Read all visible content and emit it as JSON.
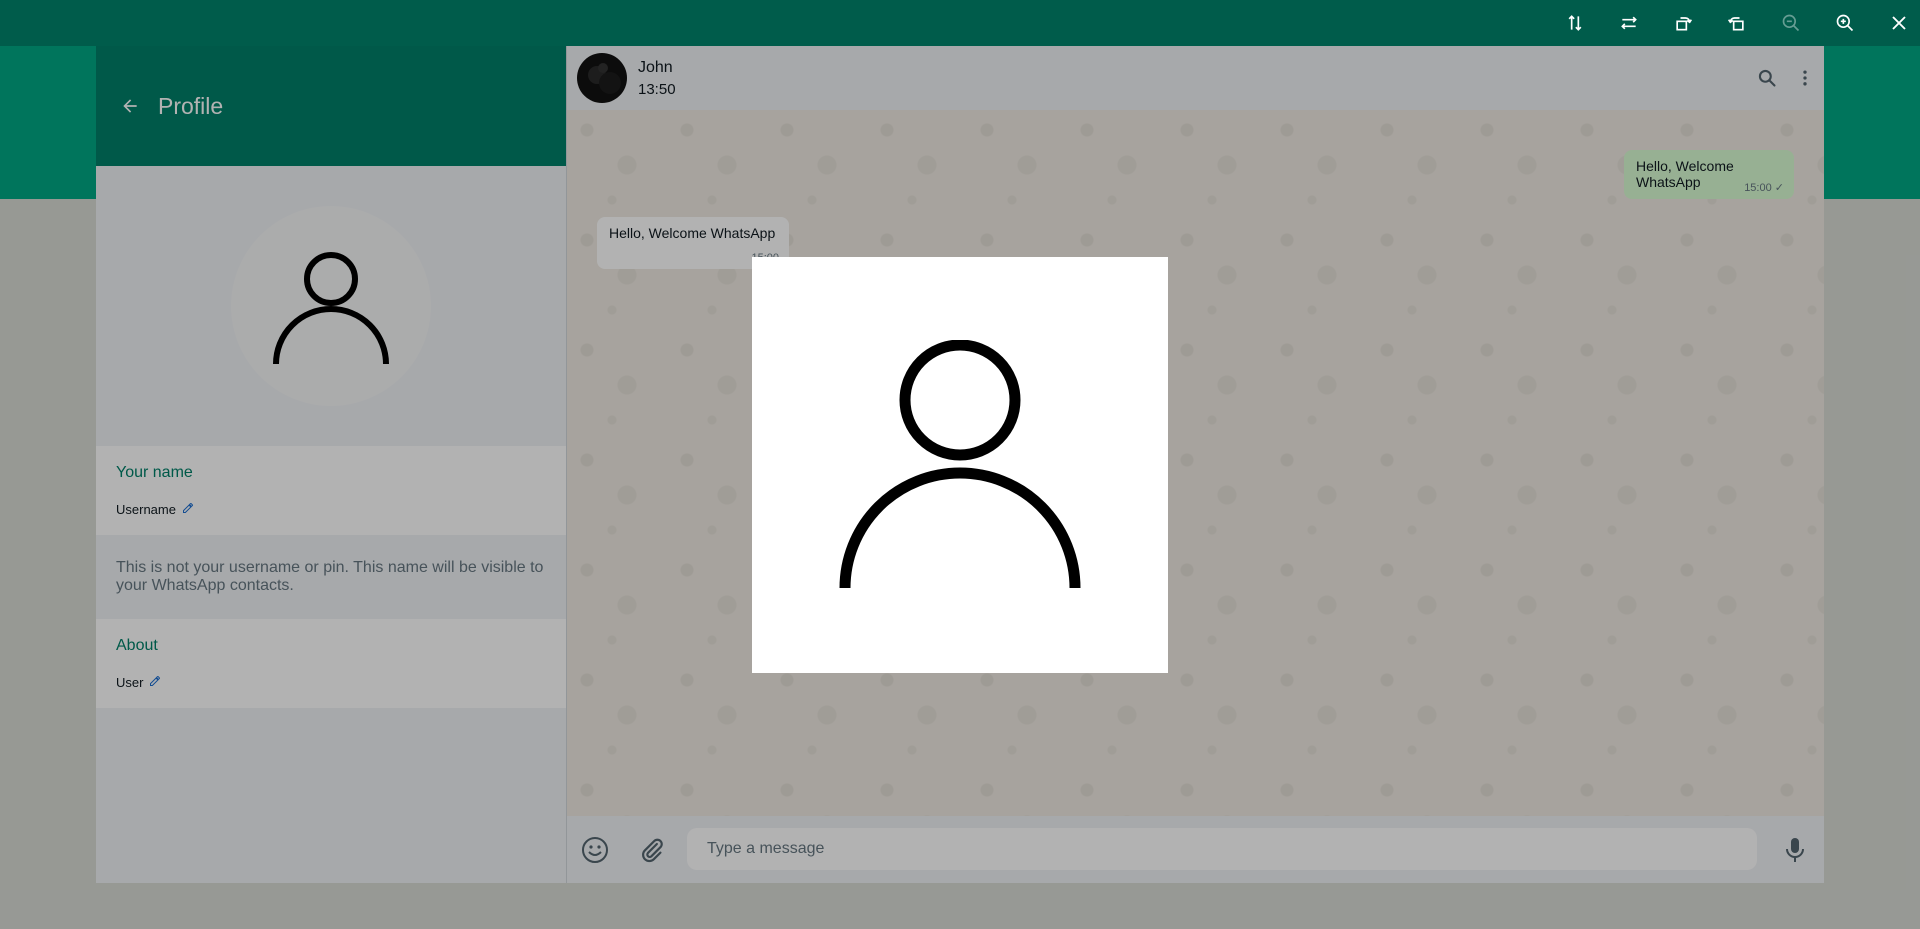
{
  "profile": {
    "header_title": "Profile",
    "name_label": "Your name",
    "name_value": "Username",
    "note": "This is not your username or pin. This name will be visible to your WhatsApp contacts.",
    "about_label": "About",
    "about_value": "User"
  },
  "chat": {
    "contact_name": "John",
    "contact_time": "13:50",
    "messages": [
      {
        "direction": "outgoing",
        "text": "Hello, Welcome WhatsApp",
        "time": "15:00",
        "status": "sent-check"
      },
      {
        "direction": "incoming",
        "text": "Hello, Welcome WhatsApp",
        "time": "15:00"
      }
    ],
    "composer_placeholder": "Type a message"
  },
  "viewer": {
    "toolbar": [
      "flip-vertical-icon",
      "flip-horizontal-icon",
      "rotate-left-icon",
      "rotate-right-icon",
      "zoom-out-icon",
      "zoom-in-icon",
      "close-icon"
    ],
    "zoom_out_disabled": true
  },
  "colors": {
    "brand_dark": "#008069",
    "brand_accent": "#00a884",
    "viewer_bar": "#005c4b",
    "outgoing_bubble": "#d9fdd3",
    "panel_bg": "#f0f2f5"
  }
}
